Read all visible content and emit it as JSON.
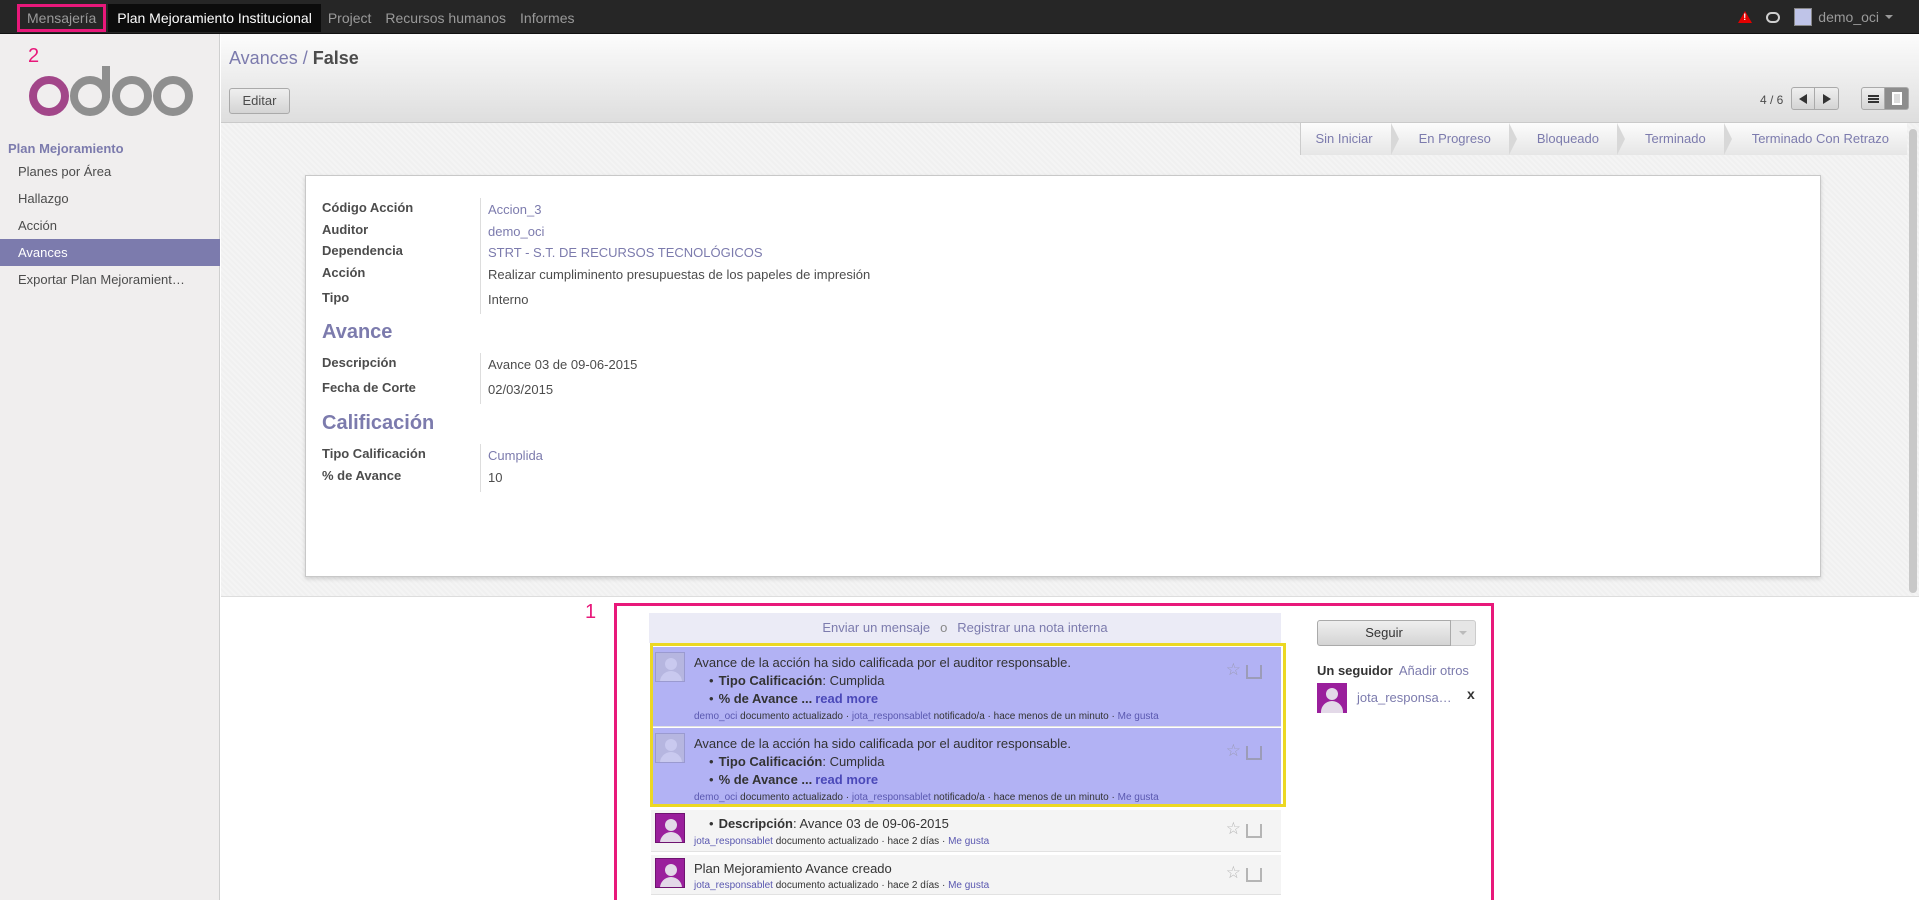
{
  "topbar": {
    "menu": [
      "Mensajería",
      "Plan Mejoramiento Institucional",
      "Project",
      "Recursos humanos",
      "Informes"
    ],
    "user": "demo_oci"
  },
  "annotations": {
    "mark1": "1",
    "mark2": "2"
  },
  "logo": {
    "text": "odoo"
  },
  "sidebar": {
    "section": "Plan Mejoramiento",
    "items": [
      "Planes por Área",
      "Hallazgo",
      "Acción",
      "Avances",
      "Exportar Plan Mejoramient…"
    ],
    "active_index": 3
  },
  "cpanel": {
    "breadcrumb_link": "Avances",
    "breadcrumb_sep": "/",
    "breadcrumb_current": "False",
    "edit_label": "Editar",
    "pager": "4 / 6"
  },
  "statusbar": [
    "Sin Iniciar",
    "En Progreso",
    "Bloqueado",
    "Terminado",
    "Terminado Con Retrazo"
  ],
  "form": {
    "codigo_label": "Código Acción",
    "codigo_value": "Accion_3",
    "auditor_label": "Auditor",
    "auditor_value": "demo_oci",
    "dependencia_label": "Dependencia",
    "dependencia_value": "STRT - S.T. DE RECURSOS TECNOLÓGICOS",
    "accion_label": "Acción",
    "accion_value": "Realizar cumpliminento presupuestas de los papeles de impresión",
    "tipo_label": "Tipo",
    "tipo_value": "Interno",
    "avance_heading": "Avance",
    "descripcion_label": "Descripción",
    "descripcion_value": "Avance 03 de 09-06-2015",
    "fecha_label": "Fecha de Corte",
    "fecha_value": "02/03/2015",
    "calificacion_heading": "Calificación",
    "tipo_cal_label": "Tipo Calificación",
    "tipo_cal_value": "Cumplida",
    "pct_label": "% de Avance",
    "pct_value": "10"
  },
  "chatter": {
    "send_message": "Enviar un mensaje",
    "or": "o",
    "log_note": "Registrar una nota interna",
    "follow_label": "Seguir",
    "followers_count": "Un seguidor",
    "add_others": "Añadir otros",
    "follower_name": "jota_responsa…",
    "follower_remove": "x",
    "messages": [
      {
        "title": "Avance de la acción ha sido calificada por el auditor responsable.",
        "b1_label": "Tipo Calificación",
        "b1_value": ": Cumplida",
        "b2_label": "% de Avance ...",
        "b2_more": "read more",
        "author": "demo_oci",
        "action": " documento actualizado · ",
        "notified": "jota_responsablet",
        "tail": " notificado/a · hace menos de un minuto · ",
        "like": "Me gusta"
      },
      {
        "title": "Avance de la acción ha sido calificada por el auditor responsable.",
        "b1_label": "Tipo Calificación",
        "b1_value": ": Cumplida",
        "b2_label": "% de Avance ...",
        "b2_more": "read more",
        "author": "demo_oci",
        "action": " documento actualizado · ",
        "notified": "jota_responsablet",
        "tail": " notificado/a · hace menos de un minuto · ",
        "like": "Me gusta"
      },
      {
        "b1_label": "Descripción",
        "b1_value": ": Avance 03 de 09-06-2015",
        "author": "jota_responsablet",
        "tail": " documento actualizado · hace 2 días · ",
        "like": "Me gusta"
      },
      {
        "title": "Plan Mejoramiento Avance creado",
        "author": "jota_responsablet",
        "tail": " documento actualizado · hace 2 días · ",
        "like": "Me gusta"
      }
    ]
  },
  "colors": {
    "accent": "#7c7bad",
    "annotation": "#e8187a",
    "highlight": "#ecd823",
    "unread": "#b2b2f4"
  }
}
